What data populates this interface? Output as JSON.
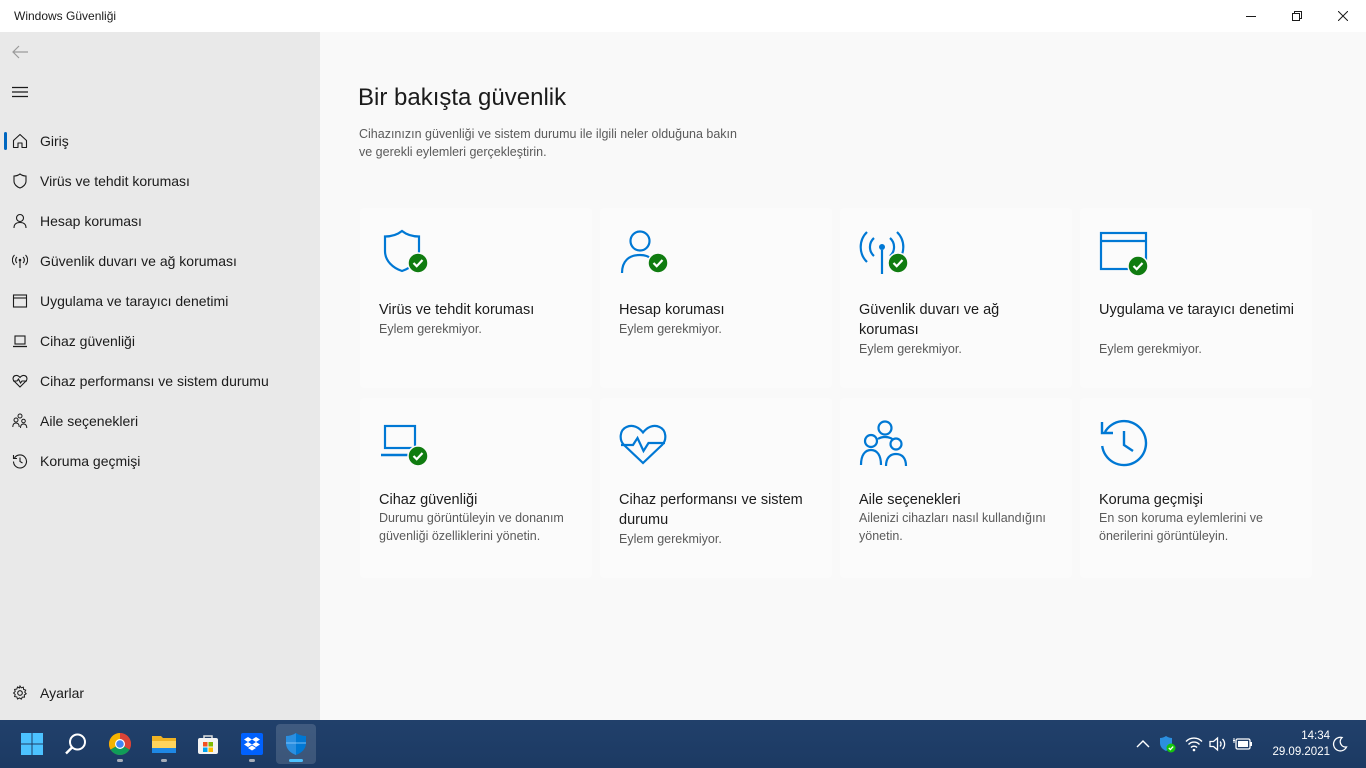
{
  "window": {
    "title": "Windows Güvenliği"
  },
  "sidebar": {
    "items": [
      {
        "label": "Giriş",
        "icon": "home-icon",
        "active": true
      },
      {
        "label": "Virüs ve tehdit koruması",
        "icon": "shield-icon"
      },
      {
        "label": "Hesap koruması",
        "icon": "person-icon"
      },
      {
        "label": "Güvenlik duvarı ve ağ koruması",
        "icon": "antenna-icon"
      },
      {
        "label": "Uygulama ve tarayıcı denetimi",
        "icon": "app-window-icon"
      },
      {
        "label": "Cihaz güvenliği",
        "icon": "laptop-icon"
      },
      {
        "label": "Cihaz performansı ve sistem durumu",
        "icon": "heart-pulse-icon"
      },
      {
        "label": "Aile seçenekleri",
        "icon": "family-icon"
      },
      {
        "label": "Koruma geçmişi",
        "icon": "history-icon"
      }
    ],
    "settings_label": "Ayarlar"
  },
  "main": {
    "title": "Bir bakışta güvenlik",
    "description": "Cihazınızın güvenliği ve sistem durumu ile ilgili neler olduğuna bakın ve gerekli eylemleri gerçekleştirin.",
    "cards": [
      {
        "title": "Virüs ve tehdit koruması",
        "desc": "Eylem gerekmiyor.",
        "icon": "shield-check-icon",
        "status_ok": true
      },
      {
        "title": "Hesap koruması",
        "desc": "Eylem gerekmiyor.",
        "icon": "person-check-icon",
        "status_ok": true
      },
      {
        "title": "Güvenlik duvarı ve ağ koruması",
        "desc": "Eylem gerekmiyor.",
        "icon": "antenna-check-icon",
        "status_ok": true
      },
      {
        "title": "Uygulama ve tarayıcı denetimi",
        "desc": "Eylem gerekmiyor.",
        "icon": "app-window-check-icon",
        "status_ok": true
      },
      {
        "title": "Cihaz güvenliği",
        "desc": "Durumu görüntüleyin ve donanım güvenliği özelliklerini yönetin.",
        "icon": "laptop-check-icon",
        "status_ok": true
      },
      {
        "title": "Cihaz performansı ve sistem durumu",
        "desc": "Eylem gerekmiyor.",
        "icon": "heart-pulse-icon"
      },
      {
        "title": "Aile seçenekleri",
        "desc": "Ailenizi cihazları nasıl kullandığını yönetin.",
        "icon": "family-icon"
      },
      {
        "title": "Koruma geçmişi",
        "desc": "En son koruma eylemlerini ve önerilerini görüntüleyin.",
        "icon": "history-icon"
      }
    ]
  },
  "taskbar": {
    "apps": [
      "start-icon",
      "search-icon",
      "chrome-icon",
      "file-explorer-icon",
      "store-icon",
      "dropbox-icon",
      "windows-security-icon"
    ],
    "time": "14:34",
    "date": "29.09.2021"
  },
  "colors": {
    "accent": "#0067c0",
    "icon_blue": "#0078d4",
    "ok_green": "#107c10",
    "sidebar_bg": "#e9e9e9",
    "main_bg": "#f9f9f9"
  }
}
